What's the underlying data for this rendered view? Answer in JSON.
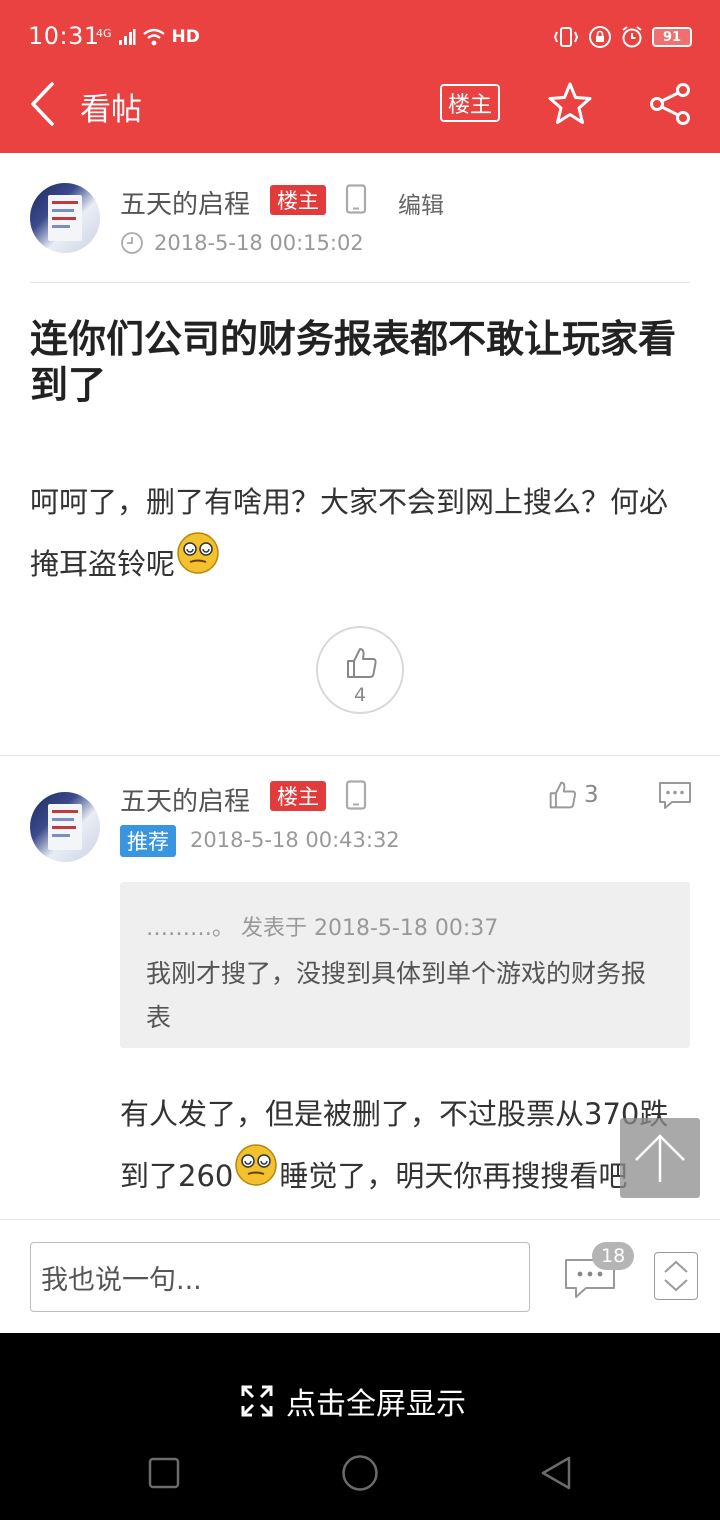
{
  "status_bar": {
    "time": "10:31",
    "network": "4G",
    "hd": "HD",
    "battery": "91"
  },
  "header": {
    "title": "看帖",
    "owner_filter_label": "楼主",
    "icons": [
      "back-arrow-icon",
      "star-icon",
      "share-icon"
    ]
  },
  "post": {
    "username": "五天的启程",
    "owner_badge": "楼主",
    "edit_label": "编辑",
    "timestamp": "2018-5-18 00:15:02",
    "title": "连你们公司的财务报表都不敢让玩家看到了",
    "body_before_emoji": "呵呵了，删了有啥用？大家不会到网上搜么？何必掩耳盗铃呢",
    "like_count": "4"
  },
  "reply": {
    "username": "五天的启程",
    "owner_badge": "楼主",
    "recommend_badge": "推荐",
    "timestamp": "2018-5-18 00:43:32",
    "like_count": "3",
    "quote": {
      "author": "………。",
      "meta": "发表于 2018-5-18 00:37",
      "text": "我刚才搜了，没搜到具体到单个游戏的财务报表"
    },
    "body_part1": "有人发了，但是被删了，不过股票从370跌到了260",
    "body_part2": "睡觉了，明天你再搜搜看吧"
  },
  "comment_bar": {
    "placeholder": "我也说一句...",
    "comment_count": "18"
  },
  "fullscreen": {
    "label": "点击全屏显示"
  },
  "colors": {
    "brand_red": "#ea4141",
    "owner_badge": "#e23b3b",
    "recommend_badge": "#3a95e0"
  }
}
